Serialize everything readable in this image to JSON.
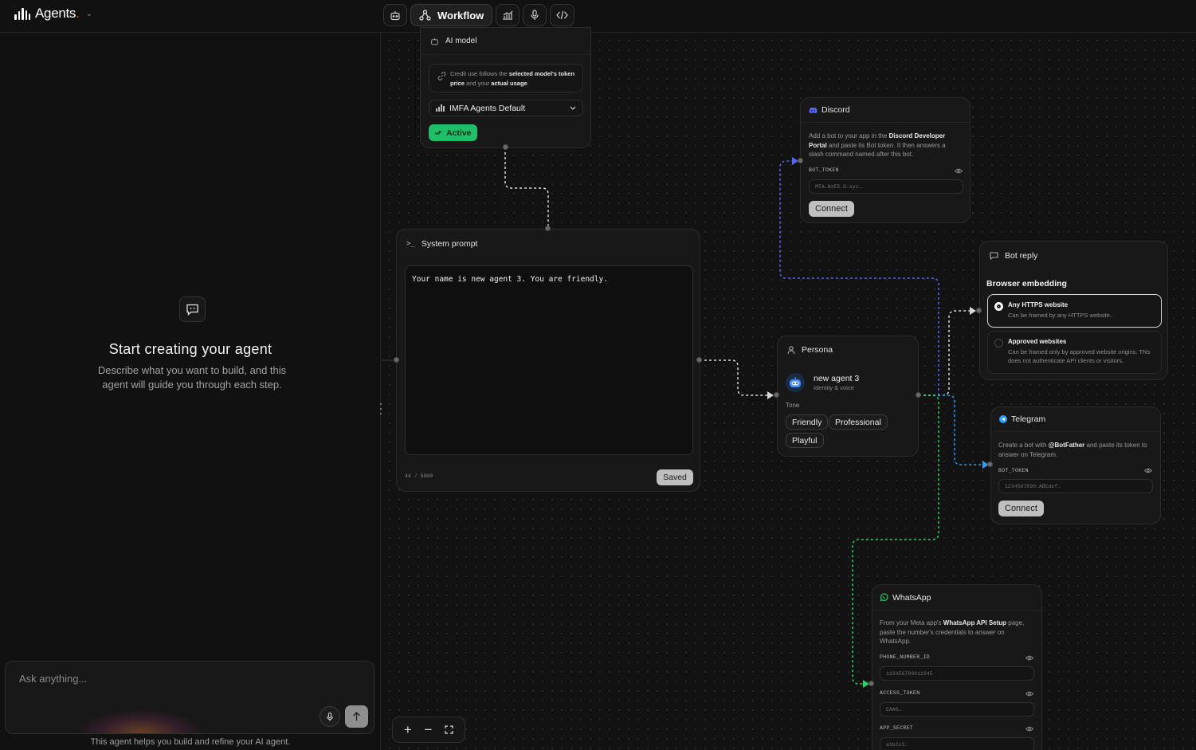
{
  "app": {
    "name": "Agents",
    "name_dot": "."
  },
  "toolbar": {
    "workflow_label": "Workflow"
  },
  "left_panel": {
    "title": "Start creating your agent",
    "subtitle": "Describe what you want to build, and this agent will guide you through each step.",
    "chat_placeholder": "Ask anything...",
    "footer": "This agent helps you build and refine your AI agent."
  },
  "nodes": {
    "ai_model": {
      "title": "AI model",
      "note_1": "Credit use follows the ",
      "note_b1": "selected model's",
      "note_2": "token price",
      "note_3": " and your ",
      "note_b2": "actual usage",
      "note_4": ".",
      "model_value": "IMFA Agents Default",
      "status": "Active"
    },
    "system_prompt": {
      "title": "System prompt",
      "text": "Your name is new agent 3. You are friendly.",
      "char_count": "44 / 5000",
      "saved_label": "Saved"
    },
    "persona": {
      "title": "Persona",
      "agent_name": "new agent 3",
      "agent_sub": "Identity & voice",
      "tone_label": "Tone",
      "tones": [
        "Friendly",
        "Professional",
        "Playful"
      ]
    },
    "discord": {
      "title": "Discord",
      "desc_1": "Add a bot to your app in the ",
      "desc_b1": "Discord Developer Portal",
      "desc_2": " and paste its Bot token. It then answers a slash command named after this bot.",
      "field_label": "BOT_TOKEN",
      "field_placeholder": "MTA…NzE5.G…xyz…",
      "connect_label": "Connect"
    },
    "bot_reply": {
      "title": "Bot reply",
      "section": "Browser embedding",
      "opt1_title": "Any HTTPS website",
      "opt1_sub": "Can be framed by any HTTPS website.",
      "opt2_title": "Approved websites",
      "opt2_sub": "Can be framed only by approved website origins. This does not authenticate API clients or visitors."
    },
    "telegram": {
      "title": "Telegram",
      "desc_1": "Create a bot with ",
      "desc_b1": "@BotFather",
      "desc_2": " and paste its token to answer on Telegram.",
      "field_label": "BOT_TOKEN",
      "field_placeholder": "1234567890:ABCdef…",
      "connect_label": "Connect"
    },
    "whatsapp": {
      "title": "WhatsApp",
      "desc_1": "From your Meta app's ",
      "desc_b1": "WhatsApp API Setup",
      "desc_2": " page, paste the number's credentials to answer on WhatsApp.",
      "field1_label": "PHONE_NUMBER_ID",
      "field1_placeholder": "123456789012345",
      "field2_label": "ACCESS_TOKEN",
      "field2_placeholder": "EAAG…",
      "field3_label": "APP_SECRET",
      "field3_placeholder": "a1b2c3…"
    }
  },
  "zoom_controls": {
    "zoom_in": "+",
    "zoom_out": "−"
  },
  "colors": {
    "active_green": "#1fbf6a",
    "discord_wire": "#5865f2",
    "telegram_wire": "#2a9df4",
    "whatsapp_wire": "#25d366",
    "neutral_wire": "#d9d9d9"
  }
}
